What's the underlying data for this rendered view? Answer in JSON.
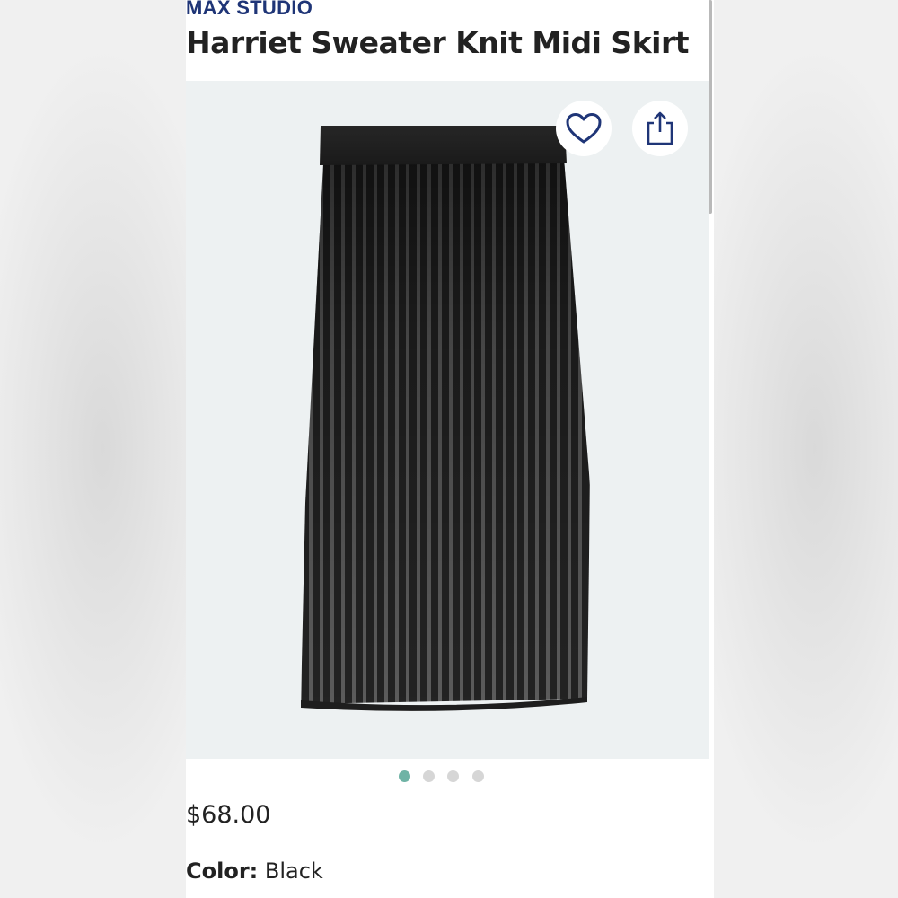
{
  "product": {
    "brand": "MAX STUDIO",
    "title": "Harriet Sweater Knit Midi Skirt",
    "price": "$68.00",
    "color_label": "Color:",
    "color_value": "Black"
  },
  "gallery": {
    "image_subject": "black-and-grey-ribbed-pleated-knit-midi-skirt",
    "total_images": 4,
    "active_index": 0
  },
  "icons": {
    "favorite": "heart-icon",
    "share": "share-icon"
  },
  "colors": {
    "brand": "#1f3577",
    "active_dot": "#6fb3a5",
    "inactive_dot": "#d6d6d6",
    "image_background": "#edf1f2"
  }
}
